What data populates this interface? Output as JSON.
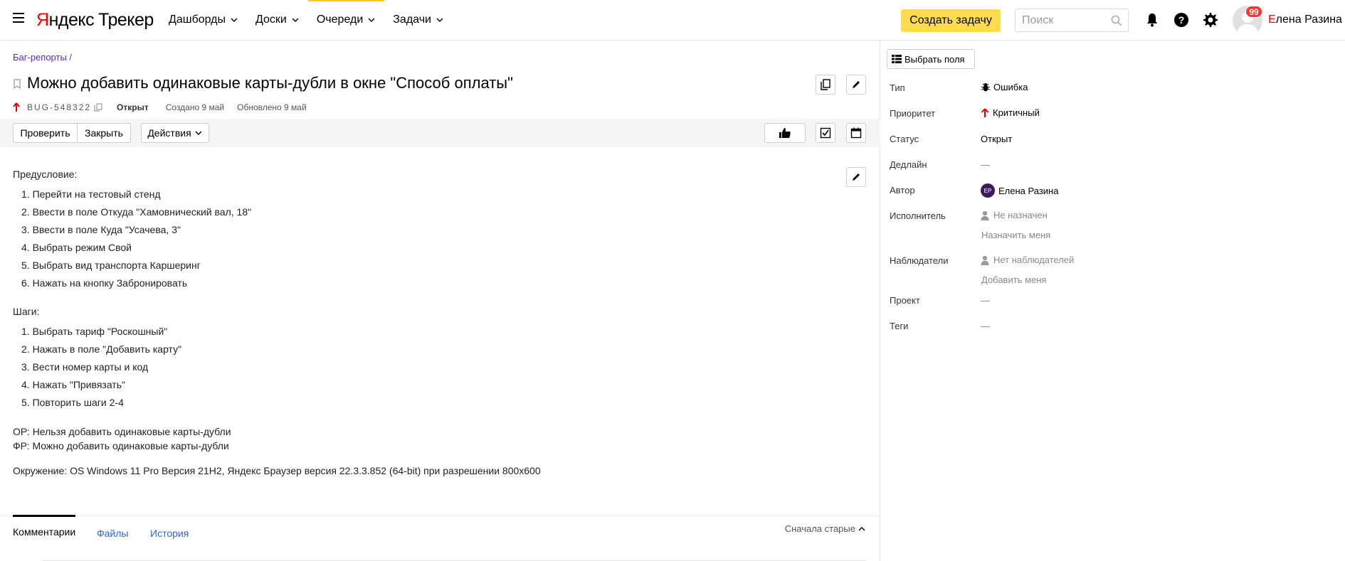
{
  "header": {
    "logo_brand_first": "Я",
    "logo_brand_rest": "ндекс",
    "logo_product": "Трекер",
    "nav": [
      {
        "label": "Дашборды"
      },
      {
        "label": "Доски"
      },
      {
        "label": "Очереди"
      },
      {
        "label": "Задачи"
      }
    ],
    "create_button": "Создать задачу",
    "search_placeholder": "Поиск",
    "notifications_badge": "99",
    "user_first_letter": "Е",
    "user_rest": "лена Разина"
  },
  "issue": {
    "breadcrumb": "Баг-репорты",
    "breadcrumb_sep": " /",
    "title": "Можно добавить одинаковые карты-дубли в окне \"Способ оплаты\"",
    "key": "BUG-548322",
    "status": "Открыт",
    "created": "Создано 9 май",
    "updated": "Обновлено 9 май"
  },
  "toolbar": {
    "check": "Проверить",
    "close": "Закрыть",
    "actions": "Действия"
  },
  "description": {
    "precondition_heading": "Предусловие:",
    "precondition_items": [
      "1. Перейти на тестовый стенд",
      "2. Ввести в поле Откуда \"Хамовнический вал, 18\"",
      "3. Ввести в поле Куда \"Усачева, 3\"",
      "4. Выбрать режим Свой",
      "5. Выбрать вид транспорта Каршеринг",
      "6. Нажать на кнопку Забронировать"
    ],
    "steps_heading": "Шаги:",
    "steps_items": [
      "1. Выбрать тариф \"Роскошный\"",
      "2. Нажать в поле \"Добавить карту\"",
      "3. Вести номер карты и код",
      "4. Нажать \"Привязать\"",
      "5. Повторить шаги 2-4"
    ],
    "expected": "ОР: Нельзя добавить одинаковые карты-дубли",
    "actual": "ФР: Можно добавить одинаковые карты-дубли",
    "environment": "Окружение: OS Windows 11 Pro Версия 21H2, Яндекс Браузер версия 22.3.3.852 (64-bit) при разрешении 800x600"
  },
  "tabs": {
    "comments": "Комментарии",
    "files": "Файлы",
    "history": "История",
    "sort": "Сначала старые"
  },
  "sidebar": {
    "choose_fields": "Выбрать поля",
    "fields": {
      "type_label": "Тип",
      "type_value": "Ошибка",
      "priority_label": "Приоритет",
      "priority_value": "Критичный",
      "status_label": "Статус",
      "status_value": "Открыт",
      "deadline_label": "Дедлайн",
      "deadline_value": "—",
      "author_label": "Автор",
      "author_initials": "ЕР",
      "author_value": "Елена Разина",
      "assignee_label": "Исполнитель",
      "assignee_value": "Не назначен",
      "assign_me": "Назначить меня",
      "watchers_label": "Наблюдатели",
      "watchers_value": "Нет наблюдателей",
      "add_me": "Добавить меня",
      "project_label": "Проект",
      "project_value": "—",
      "tags_label": "Теги",
      "tags_value": "—"
    }
  },
  "colors": {
    "accent_yellow": "#ffdb4d",
    "brand_red": "#ff0000",
    "link_blue": "#3366cc",
    "breadcrumb_purple": "#5b2ea6",
    "badge_red": "#ff3333",
    "priority_red": "#e60000"
  }
}
